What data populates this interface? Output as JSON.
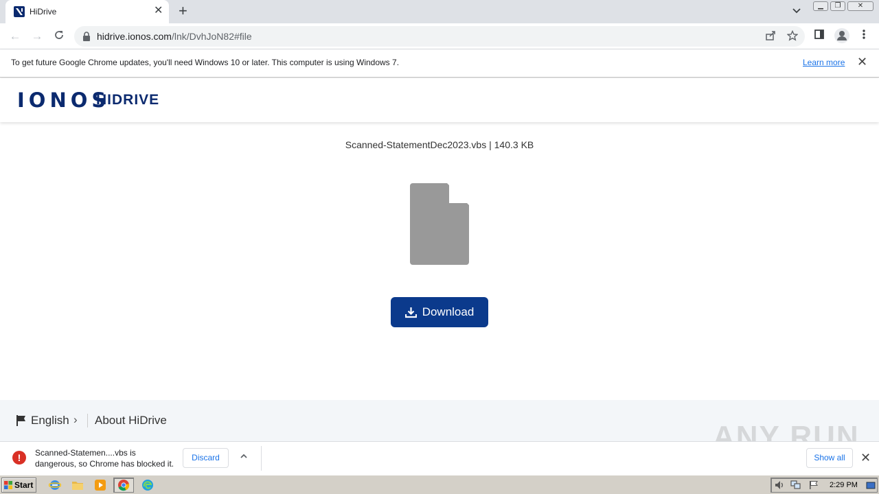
{
  "browser": {
    "tab_title": "HiDrive",
    "url_host": "hidrive.ionos.com",
    "url_path": "/lnk/DvhJoN82#file"
  },
  "infobar": {
    "message": "To get future Google Chrome updates, you'll need Windows 10 or later. This computer is using Windows 7.",
    "link": "Learn more"
  },
  "header": {
    "brand": "IONOS",
    "product": "HIDRIVE"
  },
  "file": {
    "name": "Scanned-StatementDec2023.vbs",
    "separator": "|",
    "size": "140.3 KB",
    "download_label": "Download"
  },
  "footer": {
    "language": "English",
    "about": "About HiDrive"
  },
  "watermark": "ANY RUN",
  "download_shelf": {
    "line1": "Scanned-Statemen....vbs is",
    "line2": "dangerous, so Chrome has blocked it.",
    "discard": "Discard",
    "show_all": "Show all"
  },
  "taskbar": {
    "start": "Start",
    "time": "2:29 PM"
  },
  "colors": {
    "brand": "#0b2a6f",
    "button": "#0b3a8c",
    "danger": "#d93025",
    "link": "#1a73e8"
  }
}
